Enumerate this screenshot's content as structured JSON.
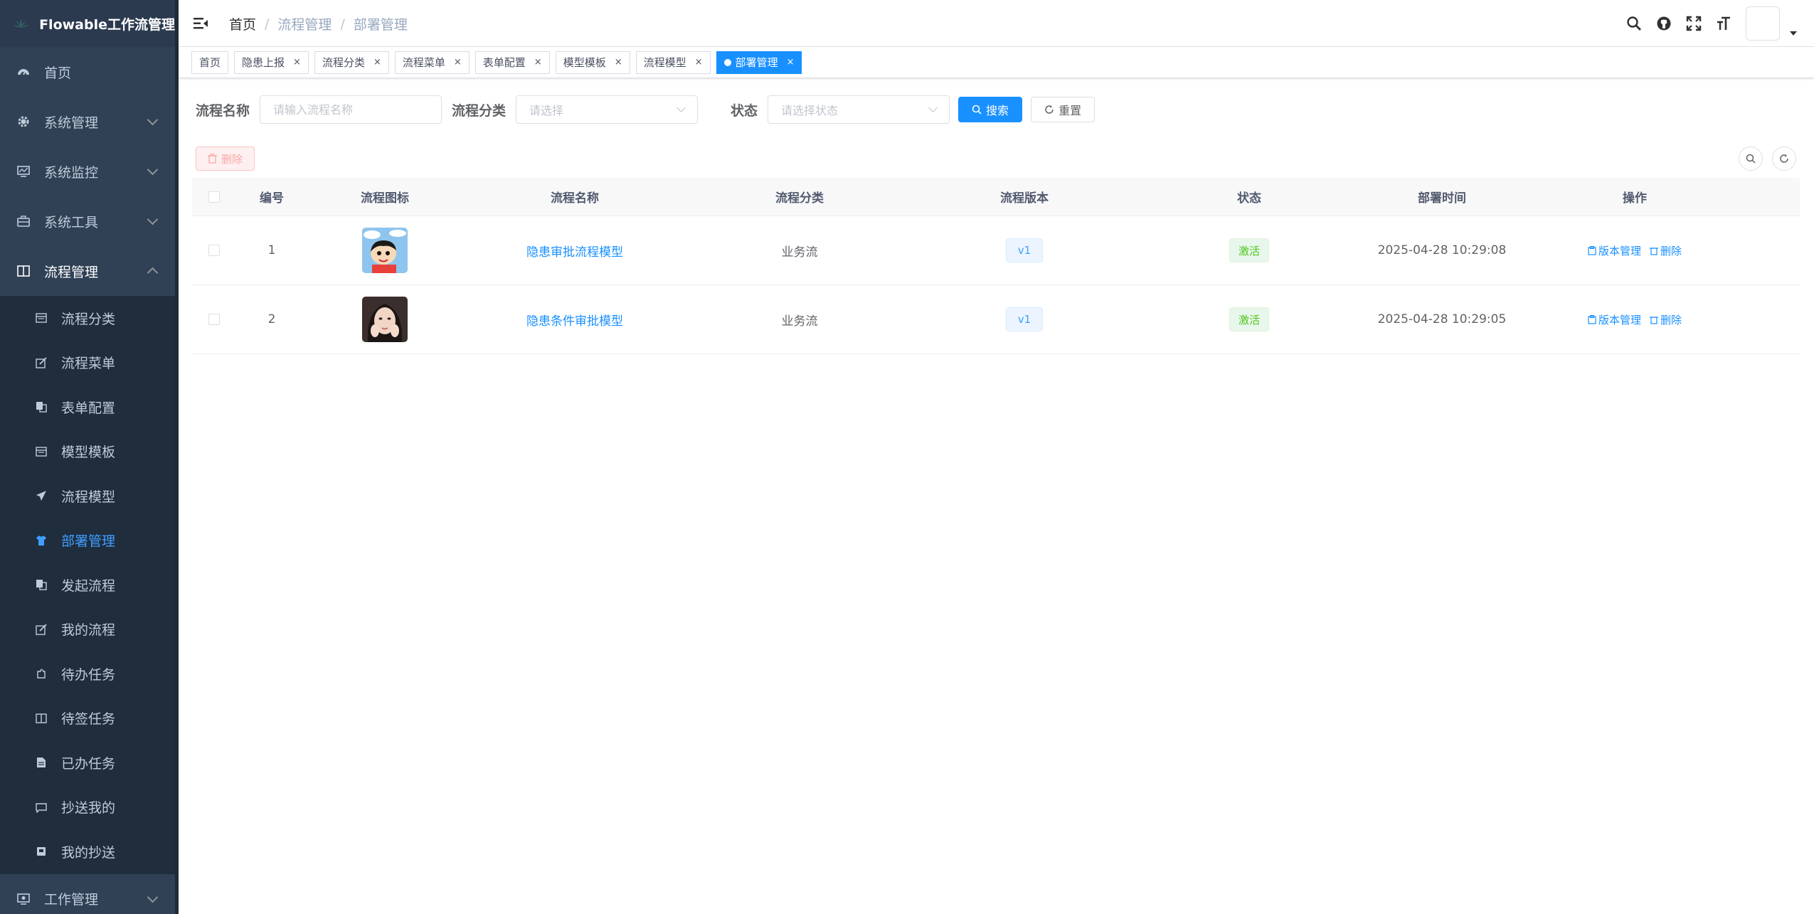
{
  "app": {
    "title": "Flowable工作流管理"
  },
  "sidebar": {
    "top_items": [
      {
        "label": "首页",
        "icon": "dashboard-icon"
      },
      {
        "label": "系统管理",
        "icon": "gear-icon"
      },
      {
        "label": "系统监控",
        "icon": "monitor-icon"
      },
      {
        "label": "系统工具",
        "icon": "toolbox-icon"
      }
    ],
    "flow_menu": {
      "label": "流程管理",
      "icon": "book-icon"
    },
    "sub_items": [
      {
        "label": "流程分类",
        "icon": "calendar-icon"
      },
      {
        "label": "流程菜单",
        "icon": "edit-icon"
      },
      {
        "label": "表单配置",
        "icon": "copy-icon"
      },
      {
        "label": "模型模板",
        "icon": "calendar-icon"
      },
      {
        "label": "流程模型",
        "icon": "send-icon"
      },
      {
        "label": "部署管理",
        "icon": "shirt-icon",
        "active": true
      },
      {
        "label": "发起流程",
        "icon": "copy-icon"
      },
      {
        "label": "我的流程",
        "icon": "edit-icon"
      },
      {
        "label": "待办任务",
        "icon": "puzzle-icon"
      },
      {
        "label": "待签任务",
        "icon": "book-icon"
      },
      {
        "label": "已办任务",
        "icon": "document-icon"
      },
      {
        "label": "抄送我的",
        "icon": "message-icon"
      },
      {
        "label": "我的抄送",
        "icon": "inbox-icon"
      }
    ],
    "bottom_items": [
      {
        "label": "工作管理",
        "icon": "desktop-icon"
      }
    ]
  },
  "breadcrumb": {
    "home": "首页",
    "items": [
      "流程管理",
      "部署管理"
    ]
  },
  "tags": [
    {
      "label": "首页",
      "closable": false
    },
    {
      "label": "隐患上报",
      "closable": true
    },
    {
      "label": "流程分类",
      "closable": true
    },
    {
      "label": "流程菜单",
      "closable": true
    },
    {
      "label": "表单配置",
      "closable": true
    },
    {
      "label": "模型模板",
      "closable": true
    },
    {
      "label": "流程模型",
      "closable": true
    },
    {
      "label": "部署管理",
      "closable": true,
      "active": true
    }
  ],
  "tag_close": "×",
  "search": {
    "name_label": "流程名称",
    "name_placeholder": "请输入流程名称",
    "category_label": "流程分类",
    "category_placeholder": "请选择",
    "status_label": "状态",
    "status_placeholder": "请选择状态",
    "search_button": "搜索",
    "reset_button": "重置"
  },
  "toolbar": {
    "delete_button": "删除"
  },
  "table": {
    "headers": [
      "编号",
      "流程图标",
      "流程名称",
      "流程分类",
      "流程版本",
      "状态",
      "部署时间",
      "操作"
    ],
    "rows": [
      {
        "id": "1",
        "name": "隐患审批流程模型",
        "category": "业务流",
        "version": "v1",
        "status": "激活",
        "time": "2025-04-28 10:29:08"
      },
      {
        "id": "2",
        "name": "隐患条件审批模型",
        "category": "业务流",
        "version": "v1",
        "status": "激活",
        "time": "2025-04-28 10:29:05"
      }
    ],
    "op_version": "版本管理",
    "op_delete": "删除"
  },
  "colors": {
    "sidebar_bg": "#304156",
    "submenu_bg": "#1f2d3d",
    "accent": "#1890ff",
    "success": "#52c41a",
    "danger": "#f56c6c"
  }
}
